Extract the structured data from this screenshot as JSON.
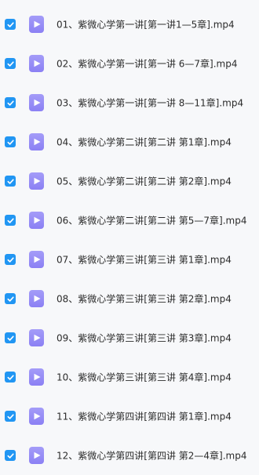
{
  "file_list": {
    "items": [
      {
        "name": "01、紫微心学第一讲[第一讲1—5章].mp4",
        "checked": true
      },
      {
        "name": "02、紫微心学第一讲[第一讲 6—7章].mp4",
        "checked": true
      },
      {
        "name": "03、紫微心学第一讲[第一讲 8—11章].mp4",
        "checked": true
      },
      {
        "name": "04、紫微心学第二讲[第二讲 第1章].mp4",
        "checked": true
      },
      {
        "name": "05、紫微心学第二讲[第二讲 第2章].mp4",
        "checked": true
      },
      {
        "name": "06、紫微心学第二讲[第二讲 第5—7章].mp4",
        "checked": true
      },
      {
        "name": "07、紫微心学第三讲[第三讲 第1章].mp4",
        "checked": true
      },
      {
        "name": "08、紫微心学第三讲[第三讲 第2章].mp4",
        "checked": true
      },
      {
        "name": "09、紫微心学第三讲[第三讲 第3章].mp4",
        "checked": true
      },
      {
        "name": "10、紫微心学第三讲[第三讲 第4章].mp4",
        "checked": true
      },
      {
        "name": "11、紫微心学第四讲[第四讲 第1章].mp4",
        "checked": true
      },
      {
        "name": "12、紫微心学第四讲[第四讲 第2—4章].mp4",
        "checked": true
      }
    ],
    "checkbox_color": "#2196f3",
    "video_icon_color": "#9b92f6",
    "file_type_icon": "video-play-icon"
  }
}
